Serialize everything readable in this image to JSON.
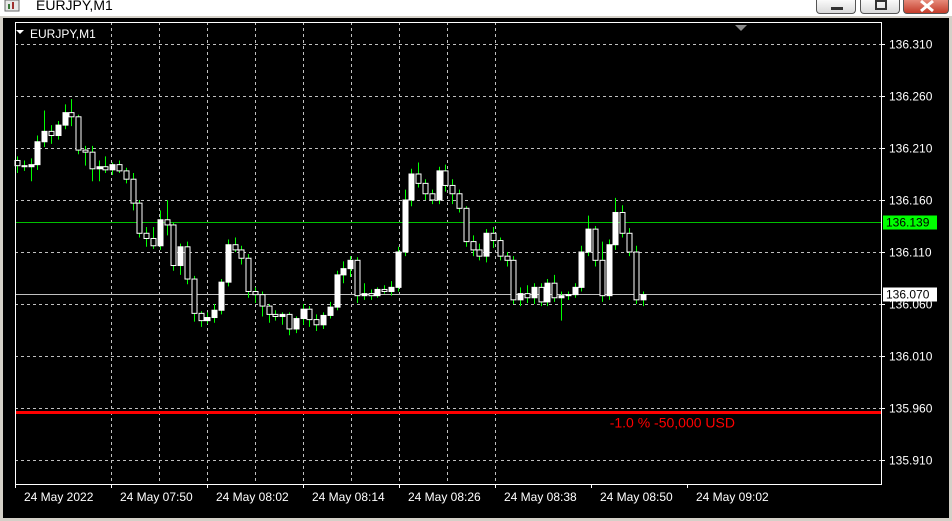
{
  "window": {
    "title": "EURJPY,M1"
  },
  "chart_label": "EURJPY,M1",
  "colors": {
    "background": "#000000",
    "grid": "#c0c0c0",
    "candle_up": "#ffffff",
    "candle_down": "#ffffff",
    "wick": "#00ff00",
    "bid_line": "#00c000",
    "bid_badge": "#00ff00",
    "ask_badge": "#ffffff",
    "sl_line": "#ff0000"
  },
  "chart_data": {
    "type": "candlestick",
    "symbol": "EURJPY",
    "timeframe": "M1",
    "y_ticks": [
      "136.310",
      "136.260",
      "136.210",
      "136.160",
      "136.110",
      "136.060",
      "136.010",
      "135.960",
      "135.910"
    ],
    "ylim": [
      135.895,
      136.325
    ],
    "x_ticks": [
      "24 May 2022",
      "24 May 07:50",
      "24 May 08:02",
      "24 May 08:14",
      "24 May 08:26",
      "24 May 08:38",
      "24 May 08:50",
      "24 May 09:02"
    ],
    "levels": [
      {
        "price": 136.139,
        "label": "136.139",
        "kind": "bid"
      },
      {
        "price": 136.07,
        "label": "136.070",
        "kind": "ask"
      },
      {
        "price": 135.956,
        "label": "-1.0 % -50,000 USD",
        "kind": "stop"
      }
    ],
    "candles": [
      [
        136.198,
        136.202,
        136.186,
        136.193
      ],
      [
        136.193,
        136.198,
        136.188,
        136.192
      ],
      [
        136.192,
        136.2,
        136.178,
        136.194
      ],
      [
        136.194,
        136.222,
        136.189,
        136.216
      ],
      [
        136.216,
        136.246,
        136.211,
        136.226
      ],
      [
        136.226,
        136.232,
        136.214,
        136.222
      ],
      [
        136.222,
        136.236,
        136.218,
        136.232
      ],
      [
        136.232,
        136.252,
        136.228,
        136.244
      ],
      [
        136.244,
        136.257,
        136.231,
        136.24
      ],
      [
        136.24,
        136.242,
        136.204,
        136.208
      ],
      [
        136.208,
        136.212,
        136.193,
        136.206
      ],
      [
        136.206,
        136.212,
        136.178,
        136.19
      ],
      [
        136.19,
        136.198,
        136.178,
        136.192
      ],
      [
        136.192,
        136.202,
        136.186,
        136.189
      ],
      [
        136.189,
        136.196,
        136.184,
        136.194
      ],
      [
        136.194,
        136.198,
        136.186,
        136.188
      ],
      [
        136.188,
        136.191,
        136.176,
        136.18
      ],
      [
        136.18,
        136.186,
        136.15,
        136.157
      ],
      [
        136.157,
        136.16,
        136.124,
        136.128
      ],
      [
        136.128,
        136.134,
        136.115,
        136.123
      ],
      [
        136.123,
        136.134,
        136.113,
        136.116
      ],
      [
        136.116,
        136.15,
        136.112,
        136.141
      ],
      [
        136.141,
        136.16,
        136.126,
        136.136
      ],
      [
        136.136,
        136.138,
        136.092,
        136.097
      ],
      [
        136.097,
        136.118,
        136.088,
        136.115
      ],
      [
        136.115,
        136.12,
        136.079,
        136.084
      ],
      [
        136.084,
        136.087,
        136.043,
        136.051
      ],
      [
        136.051,
        136.053,
        136.038,
        136.044
      ],
      [
        136.044,
        136.052,
        136.041,
        136.047
      ],
      [
        136.047,
        136.06,
        136.042,
        136.054
      ],
      [
        136.054,
        136.084,
        136.05,
        136.081
      ],
      [
        136.081,
        136.122,
        136.077,
        136.117
      ],
      [
        136.117,
        136.124,
        136.11,
        136.112
      ],
      [
        136.112,
        136.116,
        136.098,
        136.104
      ],
      [
        136.104,
        136.108,
        136.066,
        136.072
      ],
      [
        136.072,
        136.076,
        136.061,
        136.069
      ],
      [
        136.069,
        136.072,
        136.048,
        136.058
      ],
      [
        136.058,
        136.06,
        136.042,
        136.05
      ],
      [
        136.05,
        136.054,
        136.044,
        136.048
      ],
      [
        136.048,
        136.052,
        136.04,
        136.05
      ],
      [
        136.05,
        136.052,
        136.03,
        136.036
      ],
      [
        136.036,
        136.048,
        136.032,
        136.046
      ],
      [
        136.046,
        136.06,
        136.04,
        136.055
      ],
      [
        136.055,
        136.058,
        136.038,
        136.045
      ],
      [
        136.045,
        136.05,
        136.034,
        136.04
      ],
      [
        136.04,
        136.052,
        136.036,
        136.049
      ],
      [
        136.049,
        136.062,
        136.046,
        136.057
      ],
      [
        136.057,
        136.092,
        136.054,
        136.088
      ],
      [
        136.088,
        136.101,
        136.08,
        136.094
      ],
      [
        136.094,
        136.106,
        136.086,
        136.102
      ],
      [
        136.102,
        136.105,
        136.061,
        136.068
      ],
      [
        136.068,
        136.08,
        136.064,
        136.07
      ],
      [
        136.07,
        136.074,
        136.064,
        136.068
      ],
      [
        136.068,
        136.076,
        136.066,
        136.074
      ],
      [
        136.074,
        136.078,
        136.07,
        136.072
      ],
      [
        136.072,
        136.082,
        136.068,
        136.076
      ],
      [
        136.076,
        136.115,
        136.072,
        136.11
      ],
      [
        136.11,
        136.17,
        136.106,
        136.16
      ],
      [
        136.16,
        136.19,
        136.154,
        136.185
      ],
      [
        136.185,
        136.196,
        136.172,
        136.176
      ],
      [
        136.176,
        136.18,
        136.16,
        136.166
      ],
      [
        136.166,
        136.17,
        136.156,
        136.16
      ],
      [
        136.16,
        136.192,
        136.156,
        136.188
      ],
      [
        136.188,
        136.194,
        136.168,
        136.174
      ],
      [
        136.174,
        136.18,
        136.156,
        136.166
      ],
      [
        136.166,
        136.17,
        136.148,
        136.152
      ],
      [
        136.152,
        136.154,
        136.115,
        136.12
      ],
      [
        136.12,
        136.126,
        136.106,
        136.112
      ],
      [
        136.112,
        136.118,
        136.102,
        136.106
      ],
      [
        136.106,
        136.132,
        136.1,
        136.128
      ],
      [
        136.128,
        136.134,
        136.114,
        136.121
      ],
      [
        136.121,
        136.124,
        136.102,
        136.106
      ],
      [
        136.106,
        136.11,
        136.096,
        136.102
      ],
      [
        136.102,
        136.106,
        136.06,
        136.064
      ],
      [
        136.064,
        136.076,
        136.058,
        136.07
      ],
      [
        136.07,
        136.078,
        136.061,
        136.066
      ],
      [
        136.066,
        136.08,
        136.06,
        136.076
      ],
      [
        136.076,
        136.08,
        136.058,
        136.062
      ],
      [
        136.062,
        136.084,
        136.058,
        136.08
      ],
      [
        136.08,
        136.088,
        136.062,
        136.066
      ],
      [
        136.066,
        136.072,
        136.044,
        136.068
      ],
      [
        136.068,
        136.072,
        136.064,
        136.069
      ],
      [
        136.069,
        136.08,
        136.066,
        136.076
      ],
      [
        136.076,
        136.116,
        136.072,
        136.11
      ],
      [
        136.11,
        136.145,
        136.106,
        136.132
      ],
      [
        136.132,
        136.135,
        136.096,
        136.102
      ],
      [
        136.102,
        136.12,
        136.062,
        136.068
      ],
      [
        136.068,
        136.122,
        136.064,
        136.117
      ],
      [
        136.117,
        136.162,
        136.112,
        136.148
      ],
      [
        136.148,
        136.155,
        136.124,
        136.128
      ],
      [
        136.128,
        136.133,
        136.106,
        136.11
      ],
      [
        136.11,
        136.116,
        136.06,
        136.064
      ],
      [
        136.064,
        136.072,
        136.058,
        136.069
      ]
    ]
  }
}
